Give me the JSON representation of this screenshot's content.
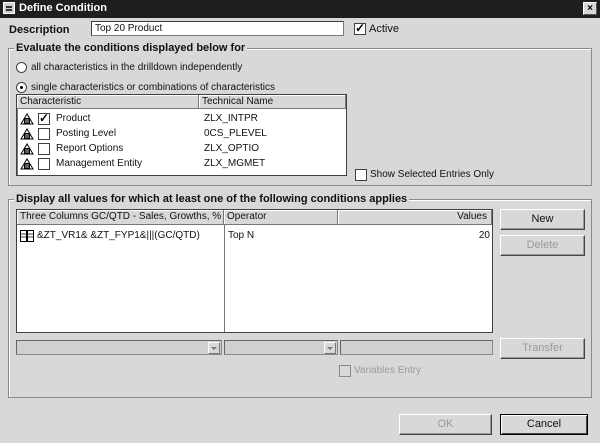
{
  "window": {
    "title": "Define Condition",
    "close_label": "×"
  },
  "description": {
    "label": "Description",
    "value": "Top 20 Product",
    "active_label": "Active",
    "active_checked": true
  },
  "evaluate": {
    "title": "Evaluate the conditions displayed below for",
    "option_all": "all characteristics in the drilldown independently",
    "option_single": "single characteristics or combinations of characteristics",
    "columns": {
      "characteristic": "Characteristic",
      "technical_name": "Technical Name"
    },
    "rows": [
      {
        "name": "Product",
        "tech": "ZLX_INTPR",
        "checked": true
      },
      {
        "name": "Posting Level",
        "tech": "0CS_PLEVEL",
        "checked": false
      },
      {
        "name": "Report Options",
        "tech": "ZLX_OPTIO",
        "checked": false
      },
      {
        "name": "Management Entity",
        "tech": "ZLX_MGMET",
        "checked": false
      }
    ],
    "show_selected_label": "Show Selected Entries Only"
  },
  "display": {
    "title": "Display all values for which at least one of the following conditions applies",
    "columns": {
      "structure": "Three Columns GC/QTD - Sales, Growths, % ...",
      "operator": "Operator",
      "values": "Values"
    },
    "rows": [
      {
        "structure": "&ZT_VR1& &ZT_FYP1&|||(GC/QTD)",
        "operator": "Top N",
        "value": "20"
      }
    ],
    "new_label": "New",
    "delete_label": "Delete",
    "transfer_label": "Transfer",
    "variables_entry_label": "Variables Entry"
  },
  "footer": {
    "ok_label": "OK",
    "cancel_label": "Cancel"
  }
}
